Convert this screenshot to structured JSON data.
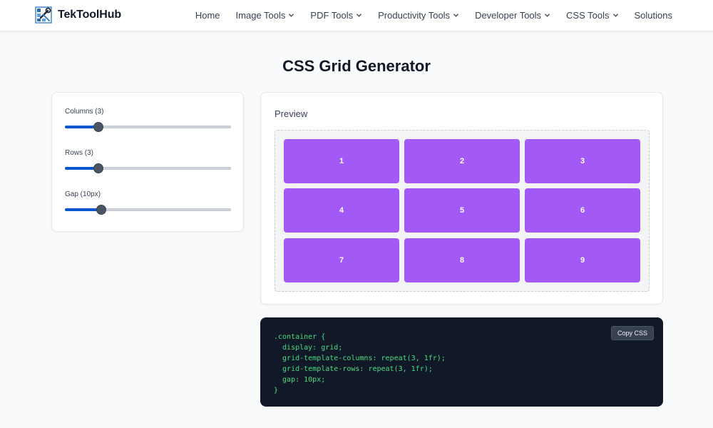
{
  "brand": {
    "name": "TekToolHub",
    "logo_icon": "wrench-grid-logo-icon"
  },
  "nav": {
    "items": [
      {
        "label": "Home",
        "dropdown": false
      },
      {
        "label": "Image Tools",
        "dropdown": true
      },
      {
        "label": "PDF Tools",
        "dropdown": true
      },
      {
        "label": "Productivity Tools",
        "dropdown": true
      },
      {
        "label": "Developer Tools",
        "dropdown": true
      },
      {
        "label": "CSS Tools",
        "dropdown": true
      },
      {
        "label": "Solutions",
        "dropdown": false
      }
    ]
  },
  "page": {
    "title": "CSS Grid Generator"
  },
  "controls": {
    "columns": {
      "label": "Columns (3)",
      "value": 3,
      "min": 1,
      "max": 12
    },
    "rows": {
      "label": "Rows (3)",
      "value": 3,
      "min": 1,
      "max": 12
    },
    "gap": {
      "label": "Gap (10px)",
      "value": 10,
      "min": 0,
      "max": 50
    }
  },
  "preview": {
    "title": "Preview",
    "cells": [
      "1",
      "2",
      "3",
      "4",
      "5",
      "6",
      "7",
      "8",
      "9"
    ]
  },
  "code": {
    "copy_label": "Copy CSS",
    "text": ".container {\n  display: grid;\n  grid-template-columns: repeat(3, 1fr);\n  grid-template-rows: repeat(3, 1fr);\n  gap: 10px;\n}"
  },
  "colors": {
    "accent": "#0b57d0",
    "cell": "#a259f5",
    "code_bg": "#111827",
    "code_text": "#4ade80"
  }
}
